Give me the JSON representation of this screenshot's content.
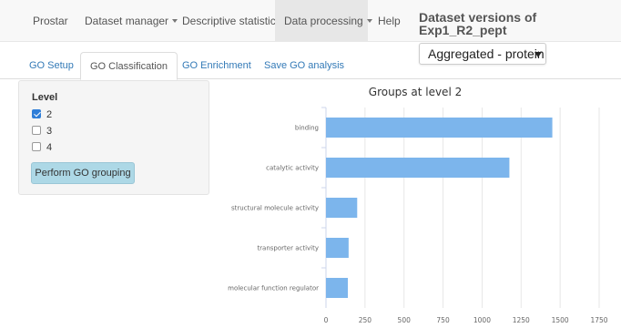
{
  "navbar": {
    "brand": "Prostar",
    "items": [
      {
        "label": "Dataset manager",
        "dropdown": true
      },
      {
        "label": "Descriptive statistics",
        "dropdown": false
      },
      {
        "label": "Data processing",
        "dropdown": true
      },
      {
        "label": "Help",
        "dropdown": false
      }
    ],
    "active_index": 2,
    "dataset_title": "Dataset versions of Exp1_R2_pept"
  },
  "dataset_select": {
    "value": "Aggregated - protein"
  },
  "tabs": [
    {
      "label": "GO Setup"
    },
    {
      "label": "GO Classification"
    },
    {
      "label": "GO Enrichment"
    },
    {
      "label": "Save GO analysis"
    }
  ],
  "active_tab": 1,
  "panel": {
    "level_label": "Level",
    "options": [
      {
        "label": "2",
        "checked": true
      },
      {
        "label": "3",
        "checked": false
      },
      {
        "label": "4",
        "checked": false
      }
    ],
    "button_label": "Perform GO grouping"
  },
  "chart_data": {
    "type": "bar",
    "orientation": "horizontal",
    "title": "Groups at level 2",
    "categories": [
      "binding",
      "catalytic activity",
      "structural molecule activity",
      "transporter activity",
      "molecular function regulator"
    ],
    "values": [
      1450,
      1175,
      200,
      145,
      140
    ],
    "xlim": [
      0,
      1750
    ],
    "xticks": [
      0,
      250,
      500,
      750,
      1000,
      1250,
      1500,
      1750
    ],
    "bar_color": "#7cb5ec",
    "grid": true
  }
}
